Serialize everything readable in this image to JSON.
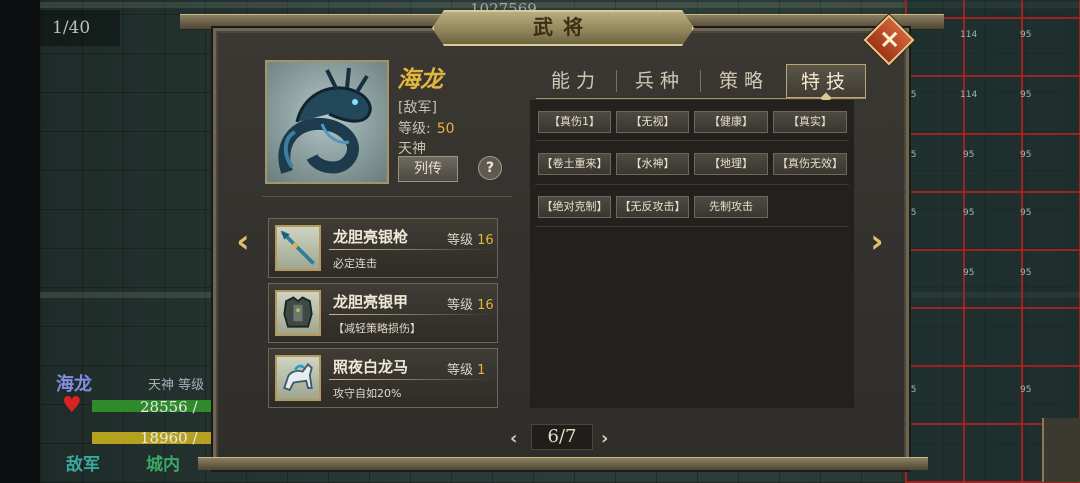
{
  "background": {
    "turn_counter": "1/40",
    "top_number": "1027569",
    "map_numbers": [
      "114",
      "95",
      "95",
      "95",
      "114",
      "95",
      "95",
      "95",
      "95",
      "95",
      "95",
      "95",
      "95",
      "95",
      "95"
    ],
    "unit": {
      "name": "海龙",
      "class_level": "天神 等级",
      "hp_text": "28556 /",
      "mp_text": "18960 /",
      "side": "敌军",
      "location": "城内"
    }
  },
  "dialog": {
    "title": "武将",
    "close_icon": "x-icon",
    "general": {
      "name": "海龙",
      "faction": "[敌军]",
      "level_label": "等级:",
      "level_value": "50",
      "class": "天神",
      "bio_button": "列传",
      "help_button": "?"
    },
    "equipment": [
      {
        "name": "龙胆亮银枪",
        "level_label": "等级",
        "level": "16",
        "desc": "必定连击",
        "icon": "spear-icon"
      },
      {
        "name": "龙胆亮银甲",
        "level_label": "等级",
        "level": "16",
        "desc": "【减轻策略损伤】",
        "icon": "armor-icon"
      },
      {
        "name": "照夜白龙马",
        "level_label": "等级",
        "level": "1",
        "desc": "攻守自如20%",
        "icon": "horse-icon"
      }
    ],
    "tabs": [
      {
        "label": "能力",
        "active": false
      },
      {
        "label": "兵种",
        "active": false
      },
      {
        "label": "策略",
        "active": false
      },
      {
        "label": "特技",
        "active": true
      }
    ],
    "skills": [
      [
        "【真伤1】",
        "【无视】",
        "【健康】",
        "【真实】"
      ],
      [
        "【卷土重来】",
        "【水神】",
        "【地理】",
        "【真伤无效】"
      ],
      [
        "【绝对克制】",
        "【无反攻击】",
        "先制攻击"
      ]
    ],
    "pager": {
      "prev": "‹",
      "current": "6/7",
      "next": "›"
    },
    "nav": {
      "left": "‹",
      "right": "›"
    }
  },
  "colors": {
    "gold": "#e2b63c",
    "frame": "#6e6650",
    "enemy": "#3aa8a0"
  }
}
